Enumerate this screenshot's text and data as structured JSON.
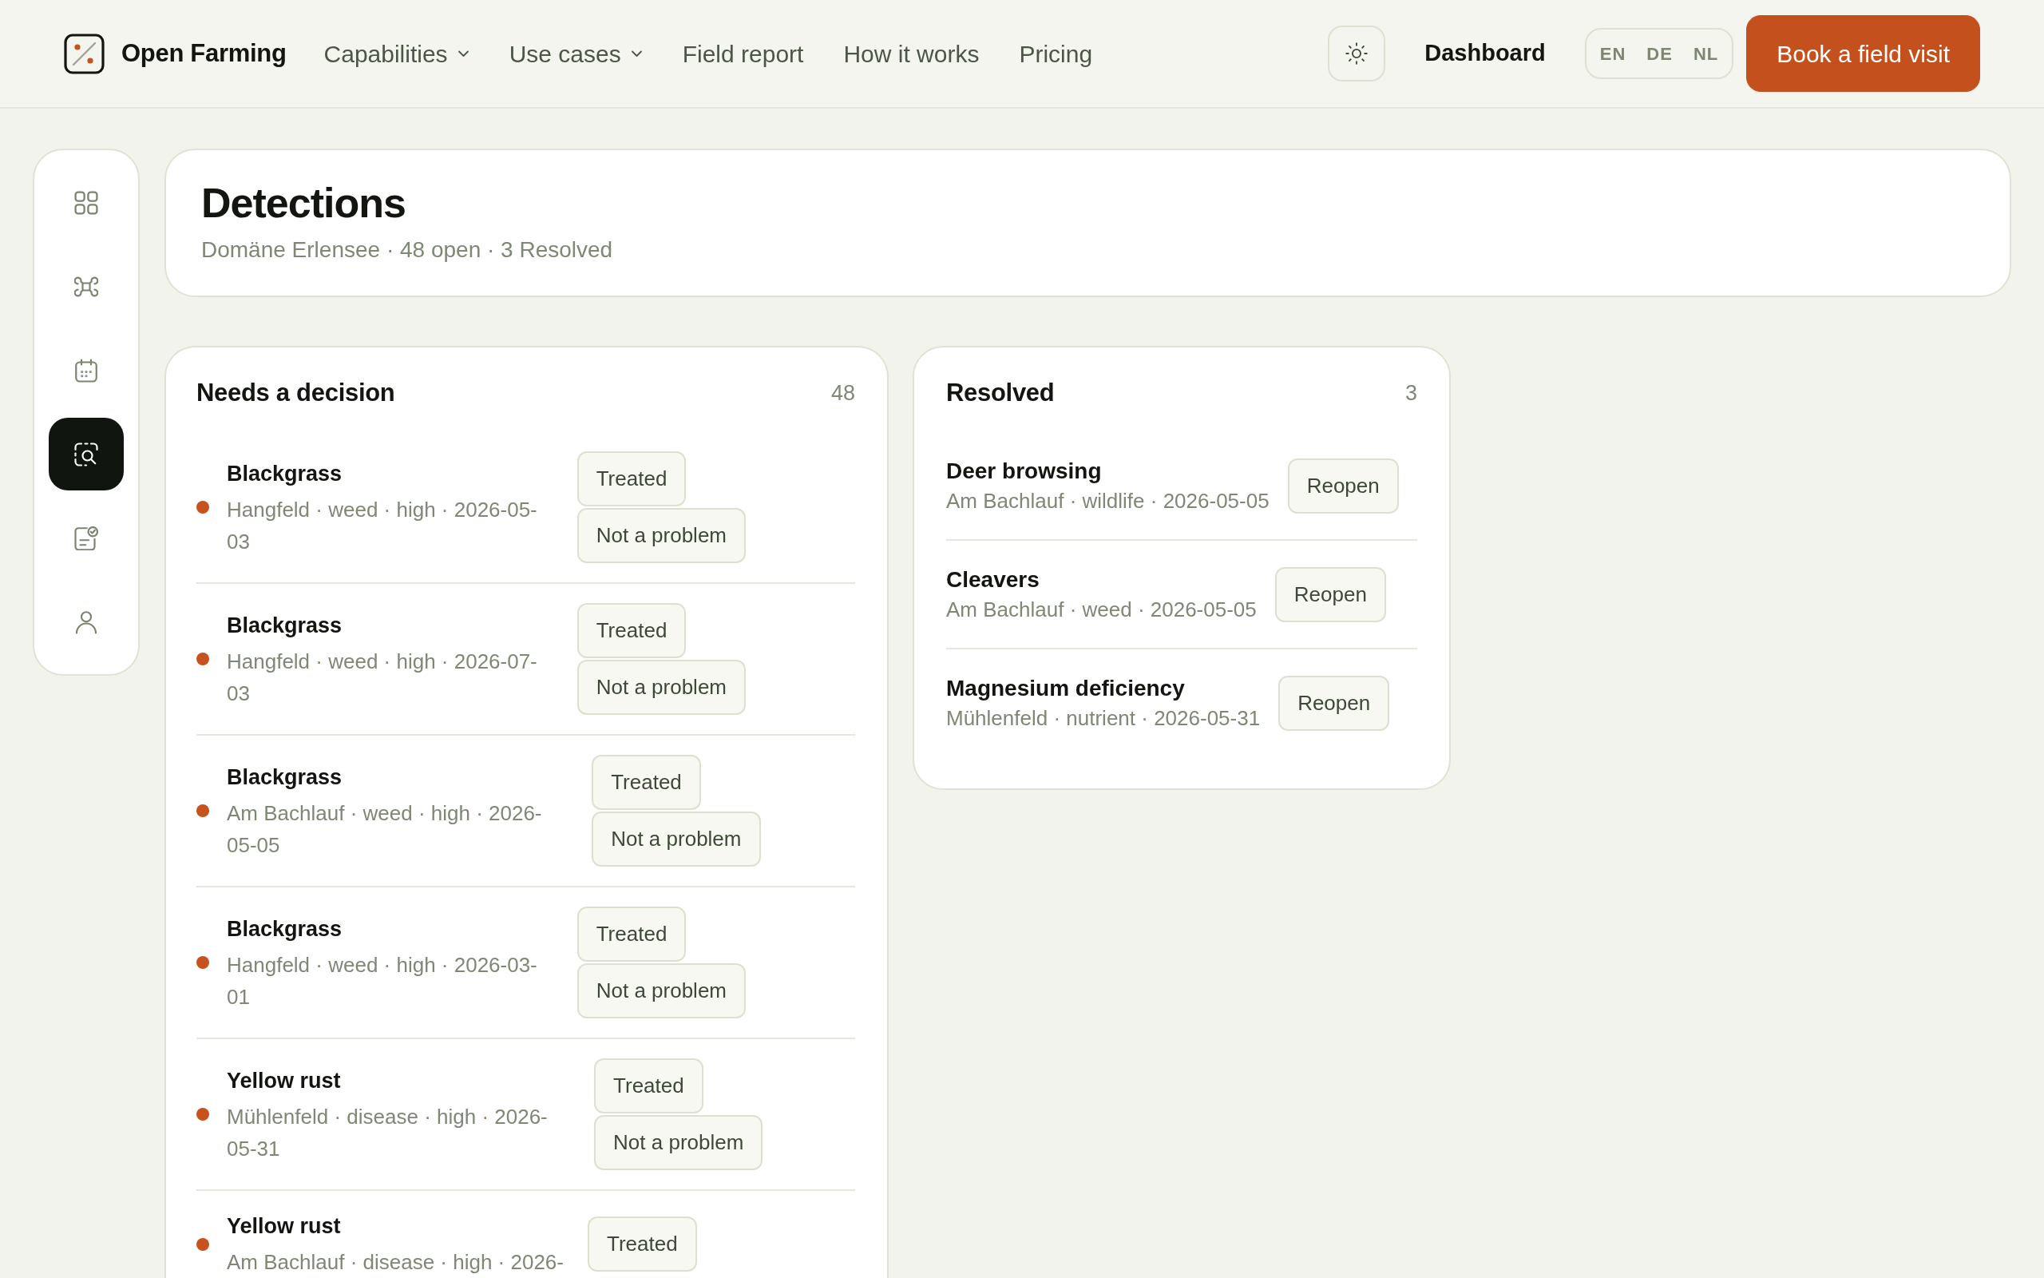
{
  "brand": {
    "name": "Open Farming"
  },
  "nav": {
    "links": [
      {
        "label": "Capabilities",
        "dropdown": true
      },
      {
        "label": "Use cases",
        "dropdown": true
      },
      {
        "label": "Field report",
        "dropdown": false
      },
      {
        "label": "How it works",
        "dropdown": false
      },
      {
        "label": "Pricing",
        "dropdown": false
      }
    ],
    "dashboard": "Dashboard",
    "languages": [
      "EN",
      "DE",
      "NL"
    ],
    "cta": "Book a field visit"
  },
  "sidebar": {
    "items": [
      {
        "selected": false
      },
      {
        "selected": false
      },
      {
        "selected": false
      },
      {
        "selected": true
      },
      {
        "selected": false
      },
      {
        "selected": false
      }
    ]
  },
  "header": {
    "title": "Detections",
    "subtitle": "Domäne Erlensee · 48 open · 3 Resolved"
  },
  "needs_decision": {
    "title": "Needs a decision",
    "count": "48",
    "items": [
      {
        "title": "Blackgrass",
        "meta": "Hangfeld · weed · high · 2026-05-03",
        "color": "#c8521e",
        "actions": [
          "Treated",
          "Not a problem"
        ]
      },
      {
        "title": "Blackgrass",
        "meta": "Hangfeld · weed · high · 2026-07-03",
        "color": "#c8521e",
        "actions": [
          "Treated",
          "Not a problem"
        ]
      },
      {
        "title": "Blackgrass",
        "meta": "Am Bachlauf · weed · high · 2026-05-05",
        "color": "#c8521e",
        "actions": [
          "Treated",
          "Not a problem"
        ]
      },
      {
        "title": "Blackgrass",
        "meta": "Hangfeld · weed · high · 2026-03-01",
        "color": "#c8521e",
        "actions": [
          "Treated",
          "Not a problem"
        ]
      },
      {
        "title": "Yellow rust",
        "meta": "Mühlenfeld · disease · high · 2026-05-31",
        "color": "#c8521e",
        "actions": [
          "Treated",
          "Not a problem"
        ]
      },
      {
        "title": "Yellow rust",
        "meta": "Am Bachlauf · disease · high · 2026-",
        "color": "#c8521e",
        "actions": [
          "Treated"
        ]
      }
    ]
  },
  "resolved": {
    "title": "Resolved",
    "count": "3",
    "items": [
      {
        "title": "Deer browsing",
        "meta": "Am Bachlauf · wildlife · 2026-05-05",
        "action": "Reopen"
      },
      {
        "title": "Cleavers",
        "meta": "Am Bachlauf · weed · 2026-05-05",
        "action": "Reopen"
      },
      {
        "title": "Magnesium deficiency",
        "meta": "Mühlenfeld · nutrient · 2026-05-31",
        "action": "Reopen"
      }
    ]
  }
}
